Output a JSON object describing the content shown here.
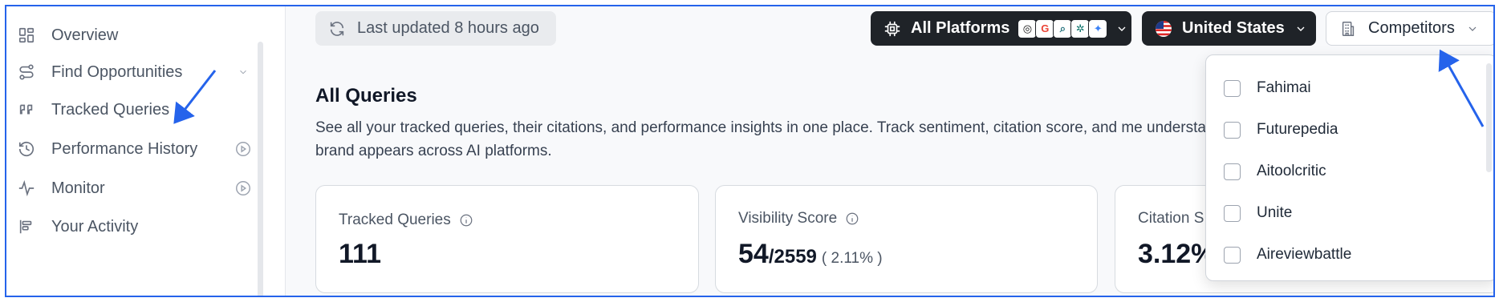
{
  "sidebar": {
    "items": [
      {
        "label": "Overview",
        "icon": "overview-icon"
      },
      {
        "label": "Find Opportunities",
        "icon": "route-icon",
        "trail": "chevron-down-icon"
      },
      {
        "label": "Tracked Queries",
        "icon": "quote-icon"
      },
      {
        "label": "Performance History",
        "icon": "history-icon",
        "trail": "play-circle-icon"
      },
      {
        "label": "Monitor",
        "icon": "activity-icon",
        "trail": "play-circle-icon"
      },
      {
        "label": "Your Activity",
        "icon": "bars-icon"
      }
    ]
  },
  "header": {
    "last_updated": "Last updated 8 hours ago",
    "platforms_label": "All Platforms",
    "country_label": "United States",
    "competitors_label": "Competitors"
  },
  "main": {
    "title": "All Queries",
    "description": "See all your tracked queries, their citations, and performance insights in one place. Track sentiment, citation score, and me understand how your brand appears across AI platforms."
  },
  "cards": [
    {
      "label": "Tracked Queries",
      "value": "111"
    },
    {
      "label": "Visibility Score",
      "value": "54",
      "sub": "/2559",
      "pct": "( 2.11% )"
    },
    {
      "label": "Citation S",
      "value": "3.12%"
    }
  ],
  "competitors_dropdown": {
    "options": [
      "Fahimai",
      "Futurepedia",
      "Aitoolcritic",
      "Unite",
      "Aireviewbattle"
    ]
  },
  "colors": {
    "accent": "#2563eb",
    "dark_pill": "#1f2328"
  }
}
